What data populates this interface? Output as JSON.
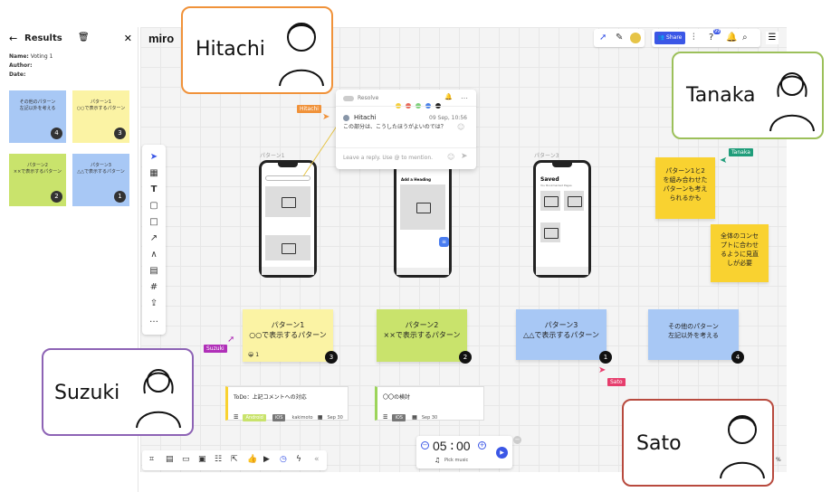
{
  "app": {
    "logo": "miro"
  },
  "results": {
    "title": "Results",
    "name_label": "Name:",
    "name_value": "Voting 1",
    "author_label": "Author:",
    "date_label": "Date:",
    "notes": [
      {
        "text": "その他のパターン\n左記以外を考える",
        "count": "4",
        "color": "#a8c8f5"
      },
      {
        "text": "パターン1\n○○で表示するパターン",
        "count": "3",
        "color": "#fbf3a4"
      },
      {
        "text": "パターン2\n××で表示するパターン",
        "count": "2",
        "color": "#c9e36c"
      },
      {
        "text": "パターン3\n△△で表示するパターン",
        "count": "1",
        "color": "#a8c8f5"
      }
    ]
  },
  "topbar": {
    "share_label": "Share",
    "notif_count": "99"
  },
  "frames": {
    "p1": "パターン1",
    "p3": "パターン3"
  },
  "comment": {
    "resolve_label": "Resolve",
    "author": "Hitachi",
    "date": "09 Sep, 10:56",
    "text": "この部分は、こうしたほうがよいのでは？",
    "reply_placeholder": "Leave a reply. Use @ to mention."
  },
  "phones": {
    "p2_heading": "Add a Heading",
    "p3_heading": "Saved",
    "p3_sub": "You Bookmarked Pages"
  },
  "stickies": {
    "s1": "パターン1\n○○で表示するパターン",
    "s1_count": "1",
    "s1_badge": "3",
    "s2": "パターン2\n××で表示するパターン",
    "s2_badge": "2",
    "s3": "パターン3\n△△で表示するパターン",
    "s3_badge": "1",
    "s4": "その他のパターン\n左記以外を考える",
    "s4_badge": "4",
    "s5": "パターン1と2\nを組み合わせた\nパターンも考え\nられるかも",
    "s6": "全体のコンセ\nプトに合わせ\nるように見直\nしが必要"
  },
  "cards": [
    {
      "title": "ToDo：上記コメントへの対応",
      "tags": [
        "Android",
        "iOS"
      ],
      "assignee": "kakimoto",
      "date": "Sep 30"
    },
    {
      "title": "〇〇の検討",
      "tags": [
        "iOS"
      ],
      "date": "Sep 30"
    }
  ],
  "timer": {
    "minutes": "05",
    "seconds": "00",
    "music_label": "Pick music"
  },
  "cursors": {
    "hitachi": "Hitachi",
    "tanaka": "Tanaka",
    "suzuki": "Suzuki",
    "sato": "Sato"
  },
  "people": {
    "hitachi": {
      "name": "Hitachi",
      "color": "#f0923a"
    },
    "tanaka": {
      "name": "Tanaka",
      "color": "#9cc05a"
    },
    "suzuki": {
      "name": "Suzuki",
      "color": "#8d63b5"
    },
    "sato": {
      "name": "Sato",
      "color": "#b84a3e"
    }
  },
  "zoom": "%"
}
